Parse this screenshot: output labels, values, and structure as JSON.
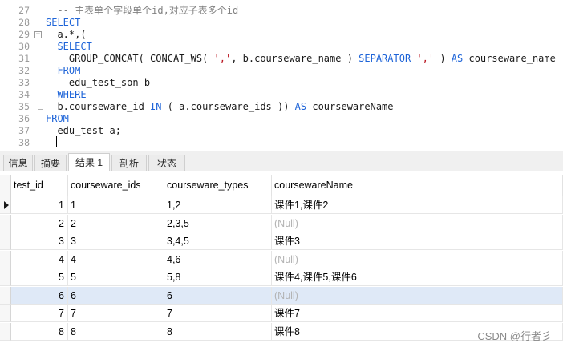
{
  "editor": {
    "lines": [
      {
        "num": "27",
        "parts": [
          {
            "t": "  ",
            "c": ""
          },
          {
            "t": "-- 主表单个字段单个id,对应子表多个id",
            "c": "cm"
          }
        ]
      },
      {
        "num": "28",
        "parts": [
          {
            "t": "SELECT",
            "c": "kw"
          }
        ]
      },
      {
        "num": "29",
        "parts": [
          {
            "t": "  a.*,(",
            "c": ""
          }
        ]
      },
      {
        "num": "30",
        "parts": [
          {
            "t": "  ",
            "c": ""
          },
          {
            "t": "SELECT",
            "c": "kw"
          }
        ]
      },
      {
        "num": "31",
        "parts": [
          {
            "t": "    GROUP_CONCAT( CONCAT_WS( ",
            "c": ""
          },
          {
            "t": "','",
            "c": "str"
          },
          {
            "t": ", b.courseware_name ) ",
            "c": ""
          },
          {
            "t": "SEPARATOR",
            "c": "kw"
          },
          {
            "t": " ",
            "c": ""
          },
          {
            "t": "','",
            "c": "str"
          },
          {
            "t": " ) ",
            "c": ""
          },
          {
            "t": "AS",
            "c": "kw"
          },
          {
            "t": " courseware_name",
            "c": ""
          }
        ]
      },
      {
        "num": "32",
        "parts": [
          {
            "t": "  ",
            "c": ""
          },
          {
            "t": "FROM",
            "c": "kw"
          }
        ]
      },
      {
        "num": "33",
        "parts": [
          {
            "t": "    edu_test_son b",
            "c": ""
          }
        ]
      },
      {
        "num": "34",
        "parts": [
          {
            "t": "  ",
            "c": ""
          },
          {
            "t": "WHERE",
            "c": "kw"
          }
        ]
      },
      {
        "num": "35",
        "parts": [
          {
            "t": "  b.courseware_id ",
            "c": ""
          },
          {
            "t": "IN",
            "c": "kw"
          },
          {
            "t": " ( a.courseware_ids )) ",
            "c": ""
          },
          {
            "t": "AS",
            "c": "kw"
          },
          {
            "t": " coursewareName",
            "c": ""
          }
        ]
      },
      {
        "num": "36",
        "parts": [
          {
            "t": "FROM",
            "c": "kw"
          }
        ]
      },
      {
        "num": "37",
        "parts": [
          {
            "t": "  edu_test a;",
            "c": ""
          }
        ]
      },
      {
        "num": "38",
        "parts": [
          {
            "t": "",
            "c": ""
          }
        ]
      }
    ]
  },
  "tabs": [
    {
      "label": "信息",
      "active": false
    },
    {
      "label": "摘要",
      "active": false
    },
    {
      "label": "结果 1",
      "active": true
    },
    {
      "label": "剖析",
      "active": false
    },
    {
      "label": "状态",
      "active": false
    }
  ],
  "grid": {
    "columns": [
      "test_id",
      "courseware_ids",
      "courseware_types",
      "coursewareName"
    ],
    "rows": [
      {
        "test_id": "1",
        "courseware_ids": "1",
        "courseware_types": "1,2",
        "coursewareName": "课件1,课件2",
        "current": true
      },
      {
        "test_id": "2",
        "courseware_ids": "2",
        "courseware_types": "2,3,5",
        "coursewareName": "(Null)"
      },
      {
        "test_id": "3",
        "courseware_ids": "3",
        "courseware_types": "3,4,5",
        "coursewareName": "课件3"
      },
      {
        "test_id": "4",
        "courseware_ids": "4",
        "courseware_types": "4,6",
        "coursewareName": "(Null)"
      },
      {
        "test_id": "5",
        "courseware_ids": "5",
        "courseware_types": "5,8",
        "coursewareName": "课件4,课件5,课件6"
      },
      {
        "test_id": "6",
        "courseware_ids": "6",
        "courseware_types": "6",
        "coursewareName": "(Null)",
        "selected": true
      },
      {
        "test_id": "7",
        "courseware_ids": "7",
        "courseware_types": "7",
        "coursewareName": "课件7"
      },
      {
        "test_id": "8",
        "courseware_ids": "8",
        "courseware_types": "8",
        "coursewareName": "课件8"
      }
    ]
  },
  "watermark": "CSDN @行者彡",
  "colors": {
    "keyword": "#1e64d8",
    "comment": "#808080",
    "string": "#b9141f",
    "null_text": "#b3b3b3",
    "selected_row": "#dfe9f7"
  }
}
